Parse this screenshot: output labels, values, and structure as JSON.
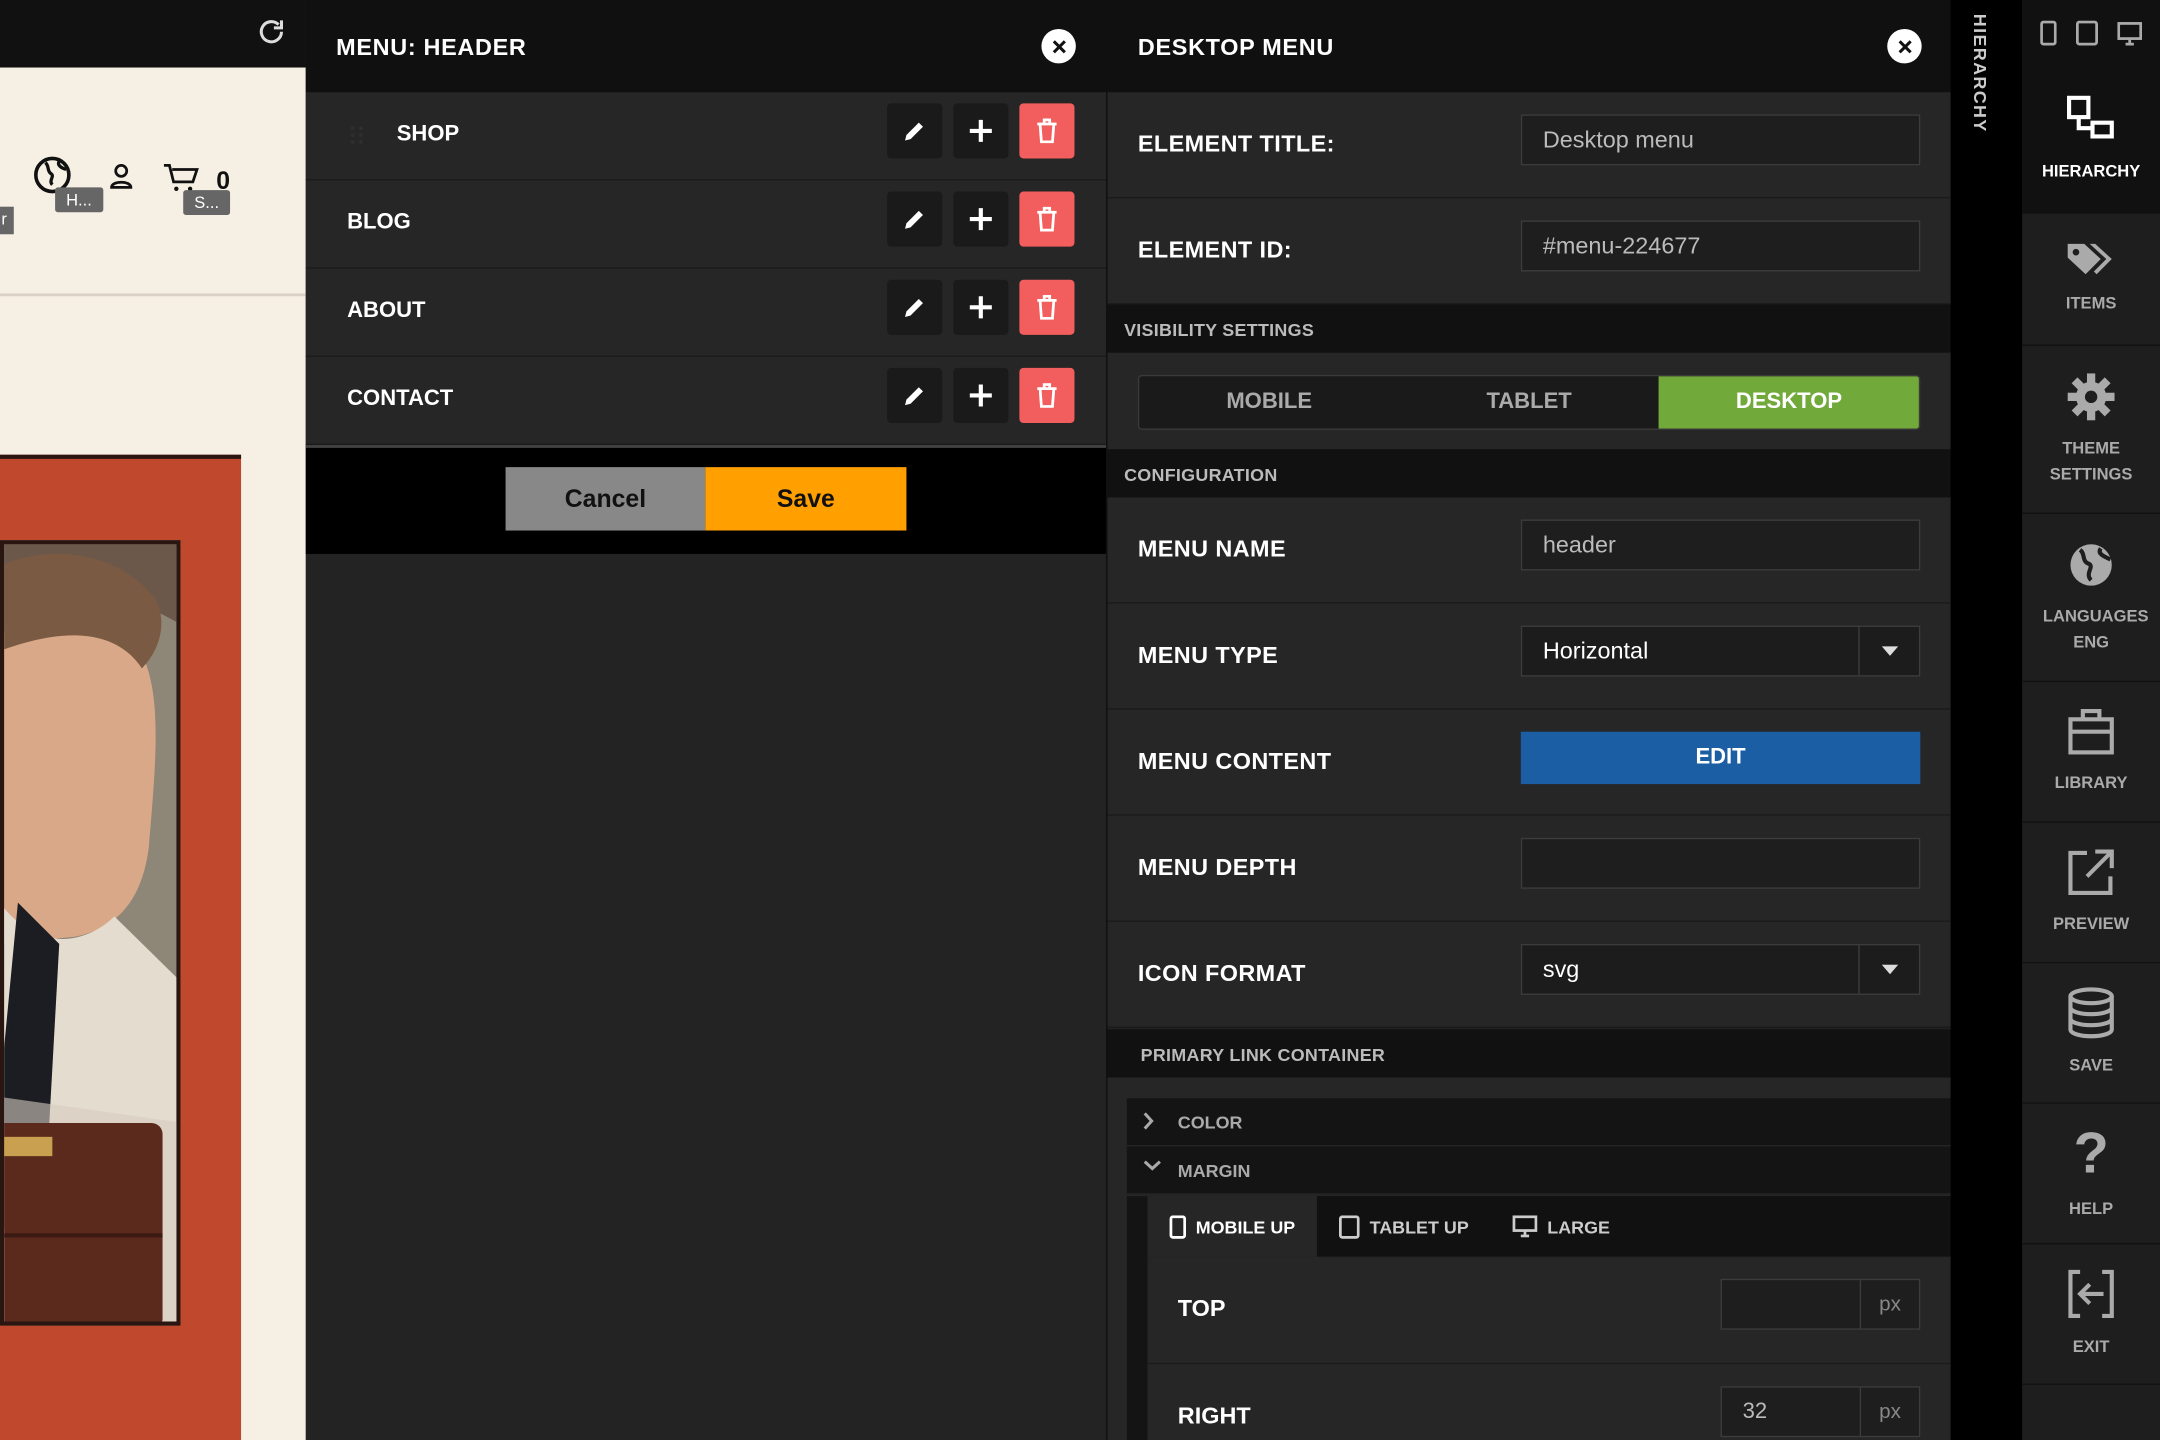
{
  "preview": {
    "tooltip_h": "H...",
    "tooltip_s": "S...",
    "tooltip_left": "r",
    "cart_count": "0"
  },
  "menu_panel": {
    "title": "MENU: HEADER",
    "items": [
      {
        "label": "SHOP"
      },
      {
        "label": "BLOG"
      },
      {
        "label": "ABOUT"
      },
      {
        "label": "CONTACT"
      }
    ],
    "cancel_label": "Cancel",
    "save_label": "Save"
  },
  "settings": {
    "title": "DESKTOP MENU",
    "element_title_label": "ELEMENT TITLE:",
    "element_title_placeholder": "Desktop menu",
    "element_id_label": "ELEMENT ID:",
    "element_id_placeholder": "#menu-224677",
    "visibility_heading": "VISIBILITY SETTINGS",
    "visibility": [
      "MOBILE",
      "TABLET",
      "DESKTOP"
    ],
    "visibility_active": "DESKTOP",
    "configuration_heading": "CONFIGURATION",
    "menu_name_label": "MENU NAME",
    "menu_name_value": "header",
    "menu_type_label": "MENU TYPE",
    "menu_type_value": "Horizontal",
    "menu_content_label": "MENU CONTENT",
    "edit_label": "EDIT",
    "menu_depth_label": "MENU DEPTH",
    "menu_depth_value": "",
    "icon_format_label": "ICON FORMAT",
    "icon_format_value": "svg",
    "primary_link_heading": "PRIMARY LINK CONTAINER",
    "color_label": "COLOR",
    "margin_label": "MARGIN",
    "breakpoints": [
      "MOBILE UP",
      "TABLET UP",
      "LARGE"
    ],
    "top_label": "TOP",
    "top_value": "",
    "right_label": "RIGHT",
    "right_value": "32",
    "unit": "px"
  },
  "hierarchy_tab": "HIERARCHY",
  "sidebar": [
    {
      "label": "HIERARCHY",
      "icon": "hierarchy-icon"
    },
    {
      "label": "ITEMS",
      "icon": "tags-icon"
    },
    {
      "label": "THEME SETTINGS",
      "icon": "gear-icon"
    },
    {
      "label": "LANGUAGES ENG",
      "icon": "globe-icon"
    },
    {
      "label": "LIBRARY",
      "icon": "library-icon"
    },
    {
      "label": "PREVIEW",
      "icon": "external-link-icon"
    },
    {
      "label": "SAVE",
      "icon": "database-icon"
    },
    {
      "label": "HELP",
      "icon": "question-icon"
    },
    {
      "label": "EXIT",
      "icon": "exit-icon"
    }
  ],
  "colors": {
    "save": "#ffa000",
    "delete": "#f25d5d",
    "desktop_active": "#72a93b",
    "edit": "#1b5ea3"
  }
}
